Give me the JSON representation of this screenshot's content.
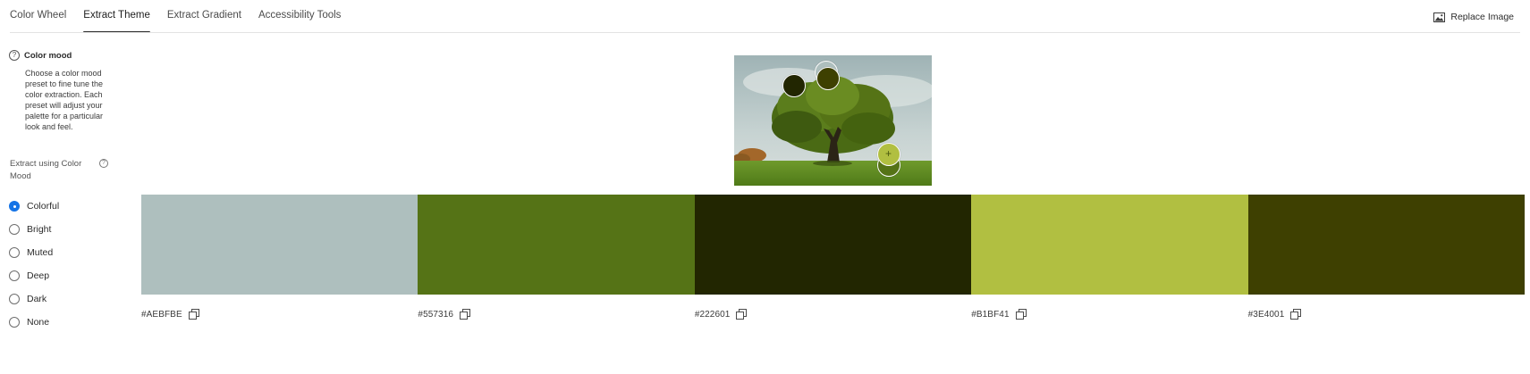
{
  "tabs": [
    {
      "label": "Color Wheel",
      "active": false
    },
    {
      "label": "Extract Theme",
      "active": true
    },
    {
      "label": "Extract Gradient",
      "active": false
    },
    {
      "label": "Accessibility Tools",
      "active": false
    }
  ],
  "header": {
    "replace_image_label": "Replace Image",
    "replace_image_icon": "image-icon"
  },
  "mood": {
    "title": "Color mood",
    "description": "Choose a color mood preset to fine tune the color extraction. Each preset will adjust your palette for a particular look and feel."
  },
  "extract": {
    "label": "Extract using Color Mood",
    "options": [
      {
        "label": "Colorful",
        "checked": true
      },
      {
        "label": "Bright",
        "checked": false
      },
      {
        "label": "Muted",
        "checked": false
      },
      {
        "label": "Deep",
        "checked": false
      },
      {
        "label": "Dark",
        "checked": false
      },
      {
        "label": "None",
        "checked": false
      }
    ]
  },
  "swatches": [
    {
      "hex": "#AEBFBE",
      "color": "#AEBFBE"
    },
    {
      "hex": "#557316",
      "color": "#557316"
    },
    {
      "hex": "#222601",
      "color": "#222601"
    },
    {
      "hex": "#B1BF41",
      "color": "#B1BF41"
    },
    {
      "hex": "#3E4001",
      "color": "#3E4001"
    }
  ],
  "colors": {
    "accent": "#1473e6",
    "active_tab_underline": "#2c2c2c"
  }
}
